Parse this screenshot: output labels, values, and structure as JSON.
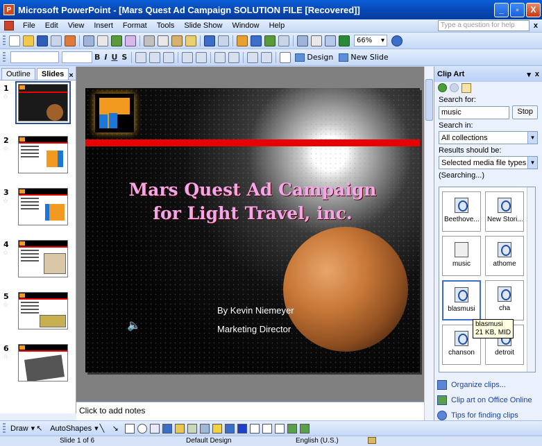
{
  "window": {
    "title": "Microsoft PowerPoint - [Mars Quest Ad Campaign SOLUTION FILE [Recovered]]",
    "minimize": "_",
    "maximize": "▫",
    "close": "X"
  },
  "menu": {
    "items": [
      "File",
      "Edit",
      "View",
      "Insert",
      "Format",
      "Tools",
      "Slide Show",
      "Window",
      "Help"
    ],
    "ask_placeholder": "Type a question for help",
    "close": "x"
  },
  "toolbar": {
    "zoom": "66%",
    "design_label": "Design",
    "new_slide_label": "New Slide",
    "bold": "B",
    "italic": "I",
    "underline": "U",
    "shadow": "S"
  },
  "left_pane": {
    "tabs": [
      "Outline",
      "Slides"
    ],
    "active_tab": "Slides",
    "close": "×",
    "slide_numbers": [
      "1",
      "2",
      "3",
      "4",
      "5",
      "6"
    ]
  },
  "slide": {
    "title_line1": "Mars Quest Ad Campaign",
    "title_line2": "for Light Travel, inc.",
    "author": "By Kevin Niemeyer",
    "role": "Marketing Director"
  },
  "notes": {
    "placeholder": "Click to add notes"
  },
  "task_pane": {
    "title": "Clip Art",
    "search_label": "Search for:",
    "search_value": "music",
    "stop_label": "Stop",
    "search_in_label": "Search in:",
    "search_in_value": "All collections",
    "results_label": "Results should be:",
    "results_value": "Selected media file types",
    "status": "(Searching...)",
    "clips": [
      {
        "name": "Beethove..."
      },
      {
        "name": "New Stori..."
      },
      {
        "name": "music"
      },
      {
        "name": "athome"
      },
      {
        "name": "blasmusi"
      },
      {
        "name": "cha"
      },
      {
        "name": "chanson"
      },
      {
        "name": "detroit"
      }
    ],
    "tooltip_line1": "blasmusi",
    "tooltip_line2": "21 KB, MID",
    "links": [
      "Organize clips...",
      "Clip art on Office Online",
      "Tips for finding clips"
    ]
  },
  "drawing_toolbar": {
    "draw_label": "Draw",
    "autoshapes_label": "AutoShapes"
  },
  "status_bar": {
    "slide_info": "Slide 1 of 6",
    "design": "Default Design",
    "language": "English (U.S.)"
  }
}
